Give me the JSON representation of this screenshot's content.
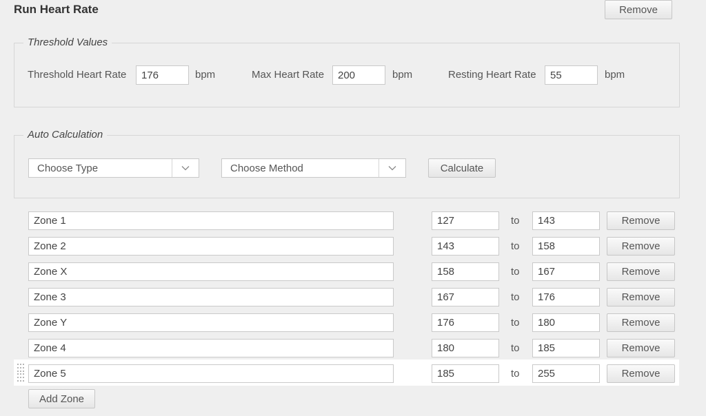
{
  "header": {
    "title": "Run Heart Rate",
    "remove_label": "Remove"
  },
  "threshold": {
    "legend": "Threshold Values",
    "fields": [
      {
        "label": "Threshold Heart Rate",
        "value": "176",
        "unit": "bpm"
      },
      {
        "label": "Max Heart Rate",
        "value": "200",
        "unit": "bpm"
      },
      {
        "label": "Resting Heart Rate",
        "value": "55",
        "unit": "bpm"
      }
    ]
  },
  "auto_calc": {
    "legend": "Auto Calculation",
    "type_select": "Choose Type",
    "method_select": "Choose Method",
    "calculate_label": "Calculate"
  },
  "zones": {
    "to_label": "to",
    "remove_label": "Remove",
    "add_label": "Add Zone",
    "rows": [
      {
        "name": "Zone 1",
        "from": "127",
        "to": "143"
      },
      {
        "name": "Zone 2",
        "from": "143",
        "to": "158"
      },
      {
        "name": "Zone X",
        "from": "158",
        "to": "167"
      },
      {
        "name": "Zone 3",
        "from": "167",
        "to": "176"
      },
      {
        "name": "Zone Y",
        "from": "176",
        "to": "180"
      },
      {
        "name": "Zone 4",
        "from": "180",
        "to": "185"
      },
      {
        "name": "Zone 5",
        "from": "185",
        "to": "255"
      }
    ]
  }
}
